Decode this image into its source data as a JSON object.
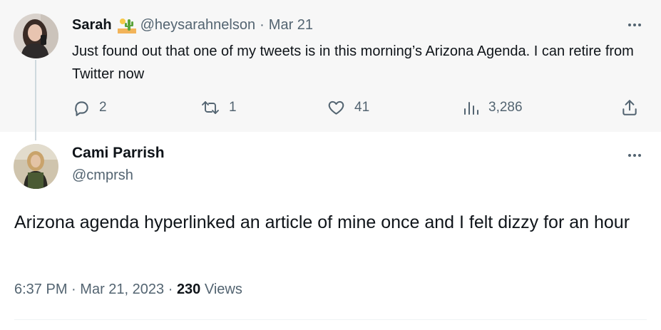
{
  "parent_tweet": {
    "name": "Sarah",
    "emoji": "cactus-desert-emoji",
    "handle": "@heysarahnelson",
    "separator": "·",
    "date": "Mar 21",
    "text": "Just found out that one of my tweets is in this morning’s Arizona Agenda. I can retire from Twitter now",
    "actions": {
      "reply_count": "2",
      "retweet_count": "1",
      "like_count": "41",
      "views_count": "3,286"
    }
  },
  "reply_tweet": {
    "name": "Cami Parrish",
    "handle": "@cmprsh",
    "text": "Arizona agenda hyperlinked an article of mine once and I felt dizzy for an hour",
    "time": "6:37 PM",
    "separator": "·",
    "date": "Mar 21, 2023",
    "views_count": "230",
    "views_label": "Views"
  },
  "colors": {
    "secondary_text": "#536471",
    "primary_text": "#0f1419",
    "parent_background": "#f7f7f7"
  }
}
